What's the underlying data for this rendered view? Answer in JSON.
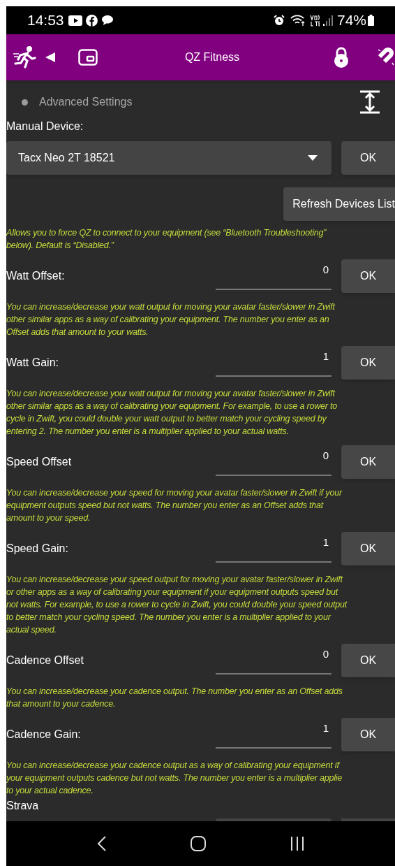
{
  "status_bar": {
    "time": "14:53",
    "battery": "74%"
  },
  "app_bar": {
    "title": "QZ Fitness"
  },
  "advanced_settings": {
    "label": "Advanced Settings"
  },
  "manual_device": {
    "label": "Manual Device:",
    "value": "Tacx Neo 2T 18521",
    "ok": "OK",
    "refresh": "Refresh Devices List",
    "description": [
      "Allows you to force QZ to connect to your equipment (see “Bluetooth Troubleshooting”",
      "below). Default is “Disabled.”"
    ]
  },
  "settings": [
    {
      "label": "Watt Offset:",
      "value": "0",
      "ok": "OK",
      "description": [
        "You can increase/decrease your watt output for moving your avatar faster/slower in Zwift",
        "other similar apps as a way of calibrating your equipment. The number you enter as an",
        "Offset adds that amount to your watts."
      ]
    },
    {
      "label": "Watt Gain:",
      "value": "1",
      "ok": "OK",
      "description": [
        "You can increase/decrease your watt output for moving your avatar faster/slower in Zwift",
        "other similar apps as a way of calibrating your equipment. For example, to use a rower to",
        "cycle in Zwift, you could double your watt output to better match your cycling speed by",
        "entering 2. The number you enter is a multiplier applied to your actual watts."
      ]
    },
    {
      "label": "Speed Offset",
      "value": "0",
      "ok": "OK",
      "description": [
        "You can increase/decrease your speed for moving your avatar faster/slower in Zwift if your",
        "equipment outputs speed but not watts. The number you enter as an Offset adds that",
        "amount to your speed."
      ]
    },
    {
      "label": "Speed Gain:",
      "value": "1",
      "ok": "OK",
      "description": [
        "You can increase/decrease your speed output for moving your avatar faster/slower in Zwift",
        "or other apps as a way of calibrating your equipment if your equipment outputs speed but",
        "not watts. For example, to use a rower to cycle in Zwift, you could double your speed output",
        "to better match your cycling speed. The number you enter is a multiplier applied to your",
        "actual speed."
      ]
    },
    {
      "label": "Cadence Offset",
      "value": "0",
      "ok": "OK",
      "description": [
        "You can increase/decrease your cadence output. The number you enter as an Offset adds",
        "that amount to your cadence."
      ]
    },
    {
      "label": "Cadence Gain:",
      "value": "1",
      "ok": "OK",
      "description": [
        "You can increase/decrease your cadence output as a way of calibrating your equipment if",
        "your equipment outputs cadence but not watts. The number you enter is a multiplier applie",
        "to your actual cadence."
      ]
    }
  ],
  "strava": {
    "label": "Strava"
  }
}
